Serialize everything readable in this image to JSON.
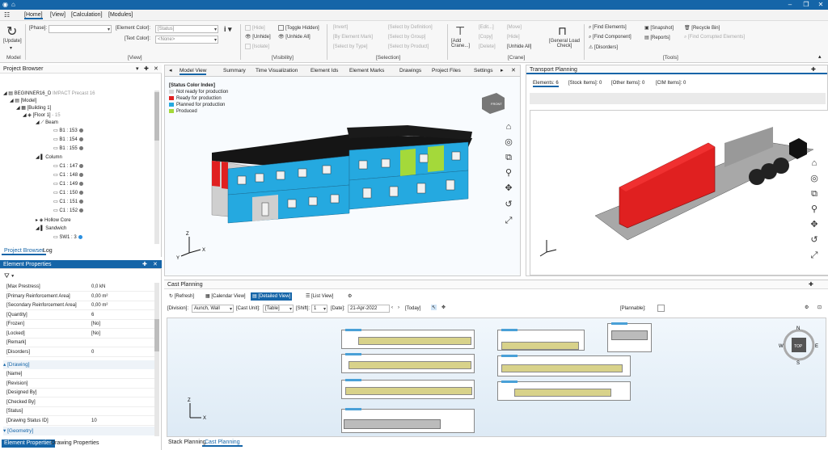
{
  "menu": [
    "[Home]",
    "[View]",
    "[Calculation]",
    "[Modules]"
  ],
  "ribbon": {
    "update": "[Update]",
    "model_group": "Model",
    "phase_label": "[Phase]:",
    "element_color_label": "[Element Color]:",
    "element_color_value": "[Status]",
    "text_color_label": "[Text Color]:",
    "text_color_value": "<None>",
    "view_group": "[View]",
    "hide": "[Hide]",
    "unhide": "[Unhide]",
    "isolate": "[Isolate]",
    "toggle_hidden": "[Toggle Hidden]",
    "unhide_all": "[Unhide All]",
    "visibility_group": "[Visibility]",
    "invert": "[Invert]",
    "by_element_mark": "[By Element Mark]",
    "by_type": "[Select by Type]",
    "by_definition": "[Select by Definition]",
    "by_group": "[Select by Group]",
    "by_product": "[Select by Product]",
    "selection_group": "[Selection]",
    "add_crane": "[Add Crane...]",
    "edit": "[Edit...]",
    "copy": "[Copy]",
    "delete": "[Delete]",
    "move": "[Move]",
    "hide_c": "[Hide]",
    "unhide_all_c": "[Unhide All]",
    "general_load": "[General Load Check]",
    "crane_group": "[Crane]",
    "find_elements": "[Find Elements]",
    "find_component": "[Find Component]",
    "disorders": "[Disorders]",
    "snapshot": "[Snapshot]",
    "reports": "[Reports]",
    "recycle_bin": "[Recycle Bin]",
    "find_corrupted": "[Find Corrupted Elements]",
    "tools_group": "[Tools]"
  },
  "browser": {
    "title": "Project Browser",
    "project": "BEGINNER16_D",
    "project_sub": "IMPACT Precast 16",
    "model": "[Model]",
    "building": "[Building 1]",
    "floor": "[Floor 1]",
    "floor_count": "- 15",
    "beam": "Beam",
    "beams": [
      "B1 : 153",
      "B1 : 154",
      "B1 : 155"
    ],
    "column": "Column",
    "columns": [
      "C1 : 147",
      "C1 : 148",
      "C1 : 149",
      "C1 : 150",
      "C1 : 151",
      "C1 : 152"
    ],
    "hollow": "Hollow Core",
    "sandwich": "Sandwich",
    "sw": "SW1 : 3",
    "tab_browser": "Project Browser",
    "tab_log": "Log"
  },
  "props": {
    "title": "Element Properties",
    "rows": [
      {
        "k": "[Max Prestress]",
        "v": "0,0 kN"
      },
      {
        "k": "[Primary Reinforcement Area]",
        "v": "0,00 m²"
      },
      {
        "k": "[Secondary Reinforcement Area]",
        "v": "0,00 m²"
      },
      {
        "k": "[Quantity]",
        "v": "6"
      },
      {
        "k": "[Frozen]",
        "v": "[No]"
      },
      {
        "k": "[Locked]",
        "v": "[No]"
      },
      {
        "k": "[Remark]",
        "v": ""
      },
      {
        "k": "[Disorders]",
        "v": "0"
      }
    ],
    "section_drawing": "[Drawing]",
    "drawing_rows": [
      {
        "k": "[Name]",
        "v": ""
      },
      {
        "k": "[Revision]",
        "v": ""
      },
      {
        "k": "[Designed By]",
        "v": ""
      },
      {
        "k": "[Checked By]",
        "v": ""
      },
      {
        "k": "[Status]",
        "v": ""
      },
      {
        "k": "[Drawing Status ID]",
        "v": "10"
      }
    ],
    "section_geometry": "[Geometry]",
    "tab_props": "Element Properties",
    "tab_drawing": "Drawing Properties"
  },
  "model_tabs": [
    "Model View",
    "Summary",
    "Time Visualization",
    "Element Ids",
    "Element Marks",
    "Drawings",
    "Project Files",
    "Settings"
  ],
  "legend": {
    "title": "[Status Color Index]",
    "items": [
      {
        "label": "Not ready for production",
        "color": "#d6d6d6"
      },
      {
        "label": "Ready for production",
        "color": "#e02020"
      },
      {
        "label": "Planned for production",
        "color": "#25a9e0"
      },
      {
        "label": "Produced",
        "color": "#a4d93a"
      }
    ]
  },
  "transport": {
    "title": "Transport Planning",
    "tabs": [
      "Elements: 6",
      "[Stock Items]: 0",
      "[Other Items]: 0",
      "[CIM Items]: 0"
    ]
  },
  "cast": {
    "title": "Cast Planning",
    "refresh": "[Refresh]",
    "calendar": "[Calendar View]",
    "detailed": "[Detailed View]",
    "list": "[List View]",
    "division_label": "[Division]:",
    "division": "Aunch, Wall",
    "cast_unit_label": "[Cast Unit]:",
    "cast_unit": "[Table]",
    "shift_label": "[Shift]:",
    "shift": "1",
    "date_label": "[Date]:",
    "date": "21-Apr-2022",
    "today": "[Today]",
    "plannable": "[Plannable]:",
    "compass": [
      "N",
      "E",
      "S",
      "W",
      "TOP"
    ],
    "tab_stack": "Stack Planning",
    "tab_cast": "Cast Planning"
  },
  "cube_label": "FRONT"
}
